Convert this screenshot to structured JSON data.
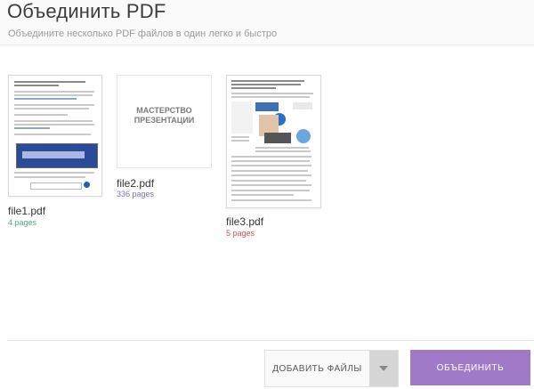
{
  "header": {
    "title": "Объединить PDF",
    "subtitle": "Объедините несколько PDF файлов в один легко и быстро"
  },
  "files": [
    {
      "name": "file1.pdf",
      "pages": "4 pages",
      "pages_color": "#4caf7a"
    },
    {
      "name": "file2.pdf",
      "pages": "336 pages",
      "pages_color": "#7b6fbf",
      "thumb_text": "МАСТЕРСТВО ПРЕЗЕНТАЦИИ"
    },
    {
      "name": "file3.pdf",
      "pages": "5 pages",
      "pages_color": "#d9534f"
    }
  ],
  "actions": {
    "add_files_label": "ДОБАВИТЬ ФАЙЛЫ",
    "merge_label": "ОБЪЕДИНИТЬ"
  },
  "colors": {
    "accent": "#a07ac9",
    "toggle": "#d6d6d6"
  }
}
